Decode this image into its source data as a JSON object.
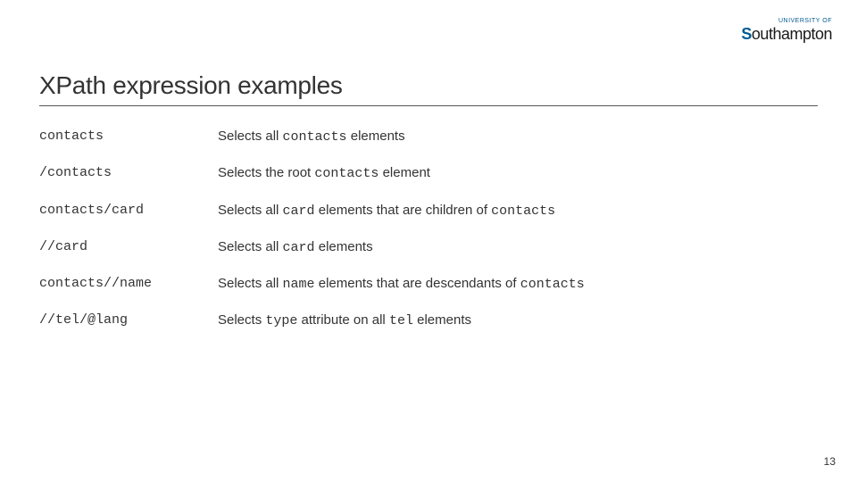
{
  "logo": {
    "top_text": "UNIVERSITY OF",
    "name_prefix": "S",
    "name_rest": "outhampton"
  },
  "title": "XPath expression examples",
  "rows": [
    {
      "expr": "contacts",
      "desc_pre": "Selects all ",
      "desc_mono": "contacts",
      "desc_post": " elements"
    },
    {
      "expr": "/contacts",
      "desc_pre": "Selects the root ",
      "desc_mono": "contacts",
      "desc_post": " element"
    },
    {
      "expr": "contacts/card",
      "desc_pre": "Selects all ",
      "desc_mono": "card",
      "desc_mid": " elements that are children of ",
      "desc_mono2": "contacts",
      "desc_post": ""
    },
    {
      "expr": "//card",
      "desc_pre": "Selects all ",
      "desc_mono": "card",
      "desc_post": " elements"
    },
    {
      "expr": "contacts//name",
      "desc_pre": "Selects all ",
      "desc_mono": "name",
      "desc_mid": " elements that are descendants of ",
      "desc_mono2": "contacts",
      "desc_post": ""
    },
    {
      "expr": "//tel/@lang",
      "desc_pre": "Selects ",
      "desc_mono": "type",
      "desc_mid": " attribute on all ",
      "desc_mono2": "tel",
      "desc_post": " elements"
    }
  ],
  "page_number": "13"
}
